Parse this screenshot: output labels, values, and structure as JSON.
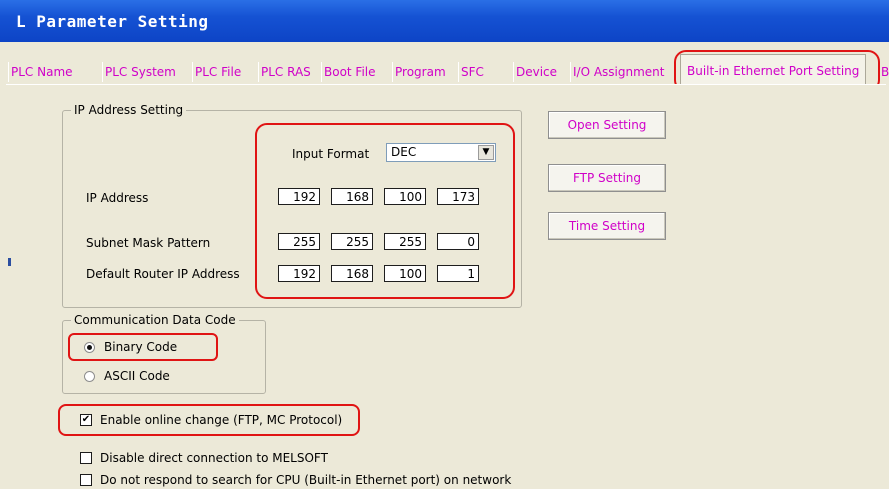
{
  "window": {
    "title": "L Parameter Setting"
  },
  "tabs": [
    "PLC Name",
    "PLC System",
    "PLC File",
    "PLC RAS",
    "Boot File",
    "Program",
    "SFC",
    "Device",
    "I/O Assignment",
    "Built-in Ethernet Port Setting",
    "B"
  ],
  "ip_group": {
    "title": "IP Address Setting",
    "input_format_label": "Input Format",
    "input_format_value": "DEC",
    "ip_label": "IP Address",
    "ip": [
      "192",
      "168",
      "100",
      "173"
    ],
    "subnet_label": "Subnet Mask Pattern",
    "subnet": [
      "255",
      "255",
      "255",
      "0"
    ],
    "router_label": "Default Router IP Address",
    "router": [
      "192",
      "168",
      "100",
      "1"
    ]
  },
  "buttons": {
    "open": "Open Setting",
    "ftp": "FTP Setting",
    "time": "Time Setting"
  },
  "comm_group": {
    "title": "Communication Data Code",
    "binary": "Binary Code",
    "ascii": "ASCII Code",
    "selected": "Binary Code"
  },
  "options": {
    "online_change": "Enable online change (FTP, MC Protocol)",
    "online_change_checked": true,
    "disable_direct": "Disable direct connection to MELSOFT",
    "disable_direct_checked": false,
    "no_respond": "Do not respond to search for CPU (Built-in Ethernet port) on network",
    "no_respond_checked": false
  },
  "colors": {
    "highlight": "#e01414",
    "tab_text": "#d000c8"
  }
}
